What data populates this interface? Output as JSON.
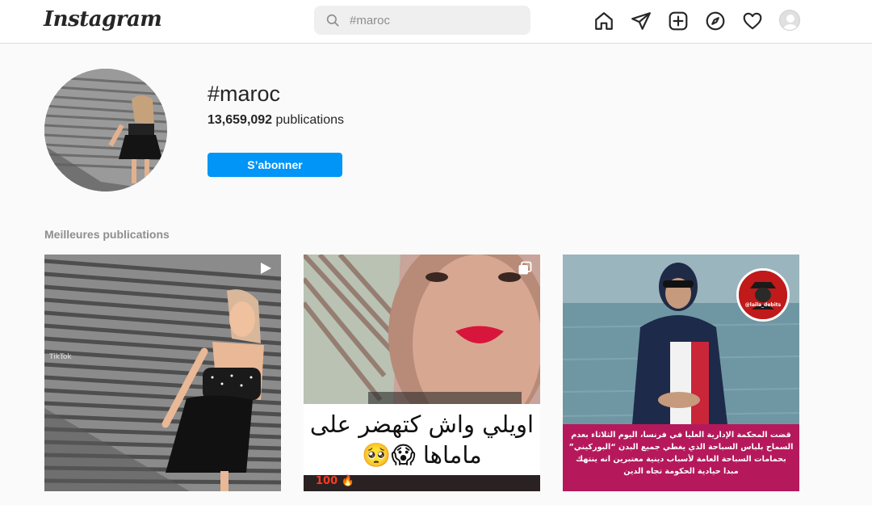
{
  "app": {
    "logo_text": "Instagram"
  },
  "search": {
    "value": "#maroc",
    "icon": "search-icon"
  },
  "nav": {
    "icons": [
      "home-icon",
      "direct-message-icon",
      "new-post-icon",
      "explore-icon",
      "activity-heart-icon",
      "profile-avatar"
    ]
  },
  "header": {
    "hashtag": "#maroc",
    "count_value": "13,659,092",
    "count_label": "publications",
    "follow_label": "S’abonner"
  },
  "top_posts": {
    "title": "Meilleures publications",
    "items": [
      {
        "type": "video",
        "icon": "video-play-icon",
        "watermark": "TikTok"
      },
      {
        "type": "carousel",
        "icon": "carousel-icon",
        "caption_line1": "اويلي واش كتهضر على",
        "caption_line2": "ماماها 😱🥺",
        "bottom_text": "100 🔥"
      },
      {
        "type": "image",
        "badge_text": "@laila_debits",
        "caption": "قضت المحكمة الإدارية العليا في فرنسا، اليوم الثلاثاء بعدم السماح بلباس السباحة الذي يغطي جميع البدن “البوركيني” بحمامات السباحة العامة لأسباب دينية معتبرين انه ينتهك مبدا حيادية الحكومة تجاه الدين"
      }
    ]
  },
  "colors": {
    "accent": "#0095f6",
    "caption_bg": "#b5195c",
    "text": "#262626",
    "muted": "#8e8e8e"
  }
}
